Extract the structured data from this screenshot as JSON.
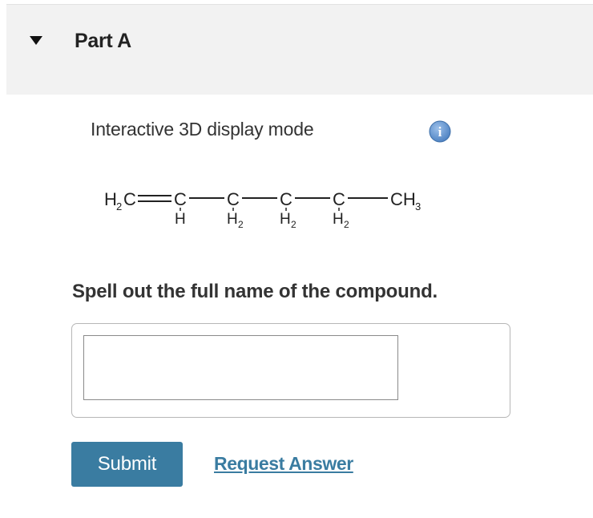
{
  "part": {
    "title": "Part A"
  },
  "display_mode": {
    "label": "Interactive 3D display mode",
    "info_icon": "i"
  },
  "molecule": {
    "atoms": [
      {
        "label": "H",
        "sub": "2",
        "tail": "C"
      },
      {
        "label": "C",
        "below": "H"
      },
      {
        "label": "C",
        "below": "H",
        "below_sub": "2"
      },
      {
        "label": "C",
        "below": "H",
        "below_sub": "2"
      },
      {
        "label": "C",
        "below": "H",
        "below_sub": "2"
      },
      {
        "label": "CH",
        "sub": "3"
      }
    ]
  },
  "question": {
    "text": "Spell out the full name of the compound."
  },
  "answer": {
    "value": "",
    "placeholder": ""
  },
  "actions": {
    "submit_label": "Submit",
    "request_label": "Request Answer"
  },
  "colors": {
    "accent": "#3a7ca1",
    "header_bg": "#f2f2f2",
    "info_blue": "#5b8ec9"
  }
}
